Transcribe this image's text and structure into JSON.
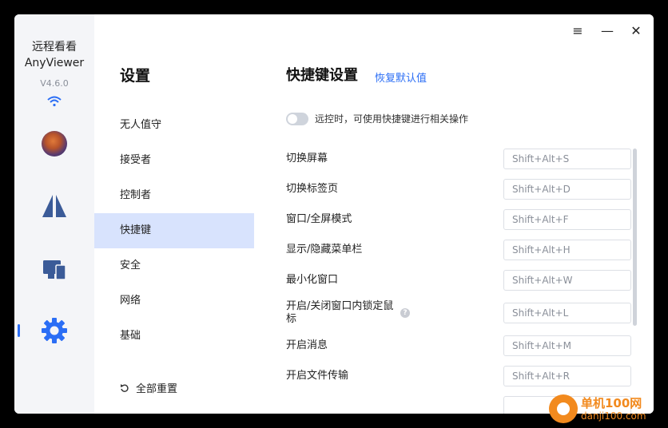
{
  "app": {
    "name_cn": "远程看看",
    "name_en": "AnyViewer",
    "version": "V4.6.0"
  },
  "rail": {
    "icons": [
      "avatar",
      "anyviewer-logo-icon",
      "devices-icon",
      "gear-icon"
    ],
    "active": "gear-icon",
    "accent_color": "#2b6ef5"
  },
  "nav": {
    "title": "设置",
    "items": [
      {
        "label": "无人值守"
      },
      {
        "label": "接受者"
      },
      {
        "label": "控制者"
      },
      {
        "label": "快捷键",
        "active": true
      },
      {
        "label": "安全"
      },
      {
        "label": "网络"
      },
      {
        "label": "基础"
      }
    ],
    "reset_label": "全部重置"
  },
  "titlebar": {
    "menu_icon": "≡",
    "minimize_icon": "—",
    "close_icon": "✕"
  },
  "main": {
    "title": "快捷键设置",
    "restore_link": "恢复默认值",
    "toggle_label": "远控时，可使用快捷键进行相关操作",
    "toggle_on": false,
    "shortcuts": [
      {
        "label": "切换屏幕",
        "key": "Shift+Alt+S"
      },
      {
        "label": "切换标签页",
        "key": "Shift+Alt+D"
      },
      {
        "label": "窗口/全屏模式",
        "key": "Shift+Alt+F"
      },
      {
        "label": "显示/隐藏菜单栏",
        "key": "Shift+Alt+H"
      },
      {
        "label": "最小化窗口",
        "key": "Shift+Alt+W"
      },
      {
        "label": "开启/关闭窗口内锁定鼠",
        "label2": "标",
        "key": "Shift+Alt+L"
      },
      {
        "label": "开启消息",
        "key": "Shift+Alt+M"
      },
      {
        "label": "开启文件传输",
        "key": "Shift+Alt+R"
      }
    ]
  },
  "watermark": {
    "cn": "单机100网",
    "url": "danji100.com"
  }
}
